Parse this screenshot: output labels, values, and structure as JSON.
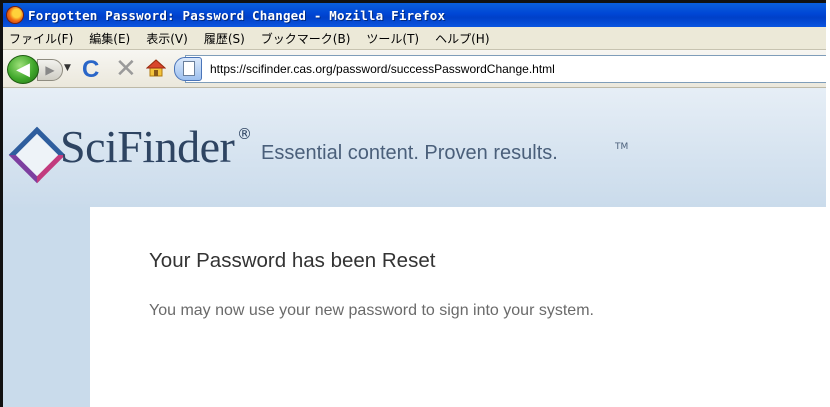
{
  "window": {
    "title": "Forgotten Password: Password Changed - Mozilla Firefox"
  },
  "menubar": {
    "items": [
      {
        "label": "ファイル(F)"
      },
      {
        "label": "編集(E)"
      },
      {
        "label": "表示(V)"
      },
      {
        "label": "履歴(S)"
      },
      {
        "label": "ブックマーク(B)"
      },
      {
        "label": "ツール(T)"
      },
      {
        "label": "ヘルプ(H)"
      }
    ]
  },
  "navbar": {
    "url": "https://scifinder.cas.org/password/successPasswordChange.html",
    "icons": [
      "back-icon",
      "forward-icon",
      "dropdown-icon",
      "reload-icon",
      "stop-icon",
      "home-icon",
      "page-icon"
    ]
  },
  "header": {
    "logo": "SciFinder",
    "registered": "®",
    "tagline": "Essential content. Proven results.",
    "trademark": "TM"
  },
  "main": {
    "heading": "Your Password has been Reset",
    "message": "You may now use your new password to sign into your system."
  },
  "colors": {
    "titlebar": "#0046d5",
    "menubar": "#ece9d8",
    "header_bg": "#cadbeb",
    "heading_text": "#333333",
    "message_text": "#6a6a6a"
  }
}
